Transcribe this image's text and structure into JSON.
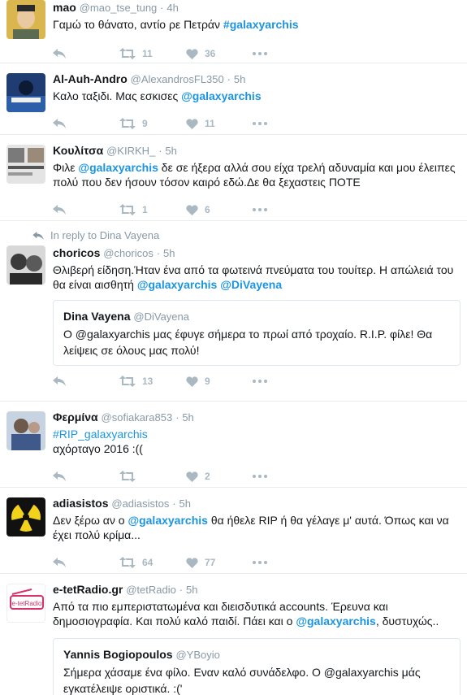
{
  "tweets": [
    {
      "name": "mao",
      "handle": "@mao_tse_tung",
      "sep": "·",
      "time": "4h",
      "text_parts": [
        "Γαμώ το θάνατο, αντίο ρε Πετράν ",
        "#galaxyarchis"
      ],
      "retweets": "11",
      "likes": "36"
    },
    {
      "name": "Al-Auh-Andro",
      "handle": "@AlexandrosFL350",
      "sep": "·",
      "time": "5h",
      "text_parts": [
        "Καλο ταξιδι. Μας εσκισες ",
        "@galaxyarchis"
      ],
      "retweets": "9",
      "likes": "11"
    },
    {
      "name": "Κουλίτσα",
      "handle": "@KIRKH_",
      "sep": "·",
      "time": "5h",
      "text_parts": [
        "Φιλε ",
        "@galaxyarchis",
        " δε σε ήξερα αλλά σου είχα τρελή αδυναμία και μου έλειπες πολύ που δεν ήσουν τόσον καιρό εδώ.Δε θα ξεχαστεις ΠΟΤΕ"
      ],
      "retweets": "1",
      "likes": "6"
    },
    {
      "reply_context": "In reply to Dina Vayena",
      "name": "choricos",
      "handle": "@choricos",
      "sep": "·",
      "time": "5h",
      "text_parts": [
        "Θλιβερή είδηση.Ήταν ένα από τα φωτεινά πνεύματα του τουίτερ. Η απώλειά του θα είναι αισθητή ",
        "@galaxyarchis",
        " ",
        "@DiVayena"
      ],
      "quote": {
        "name": "Dina Vayena",
        "handle": "@DiVayena",
        "text": "Ο @galaxyarchis μας έφυγε σήμερα το πρωί από τροχαίο. R.I.P. φίλε! Θα λείψεις σε όλους μας πολύ!"
      },
      "retweets": "13",
      "likes": "9"
    },
    {
      "name": "Φερμίνα",
      "handle": "@sofiakara853",
      "sep": "·",
      "time": "5h",
      "hashtag": "#RIP_galaxyarchis",
      "text2": "αχόρταγο 2016 :((",
      "retweets": "",
      "likes": "2"
    },
    {
      "name": "adiasistos",
      "handle": "@adiasistos",
      "sep": "·",
      "time": "5h",
      "text_parts": [
        "Δεν ξέρω αν ο ",
        "@galaxyarchis",
        " θα ήθελε RIP ή θα γέλαγε μ' αυτά. Όπως και να έχει πολύ κρίμα..."
      ],
      "retweets": "64",
      "likes": "77"
    },
    {
      "name": "e-tetRadio.gr",
      "handle": "@tetRadio",
      "sep": "·",
      "time": "5h",
      "avatar_text": "e-tetRadio",
      "text_parts": [
        "Από τα πιο εμπεριστατωμένα και διεισδυτικά accounts. Έρευνα και δημοσιογραφία. Και πολύ καλό παιδί. Πάει και ο ",
        "@galaxyarchis",
        ", δυστυχώς.."
      ],
      "quote": {
        "name": "Yannis Bogiopoulos",
        "handle": "@YBoyio",
        "text": "Σήμερα χάσαμε ένα φίλο. Εναν καλό συνάδελφο. Ο @galaxyarchis μάς εγκατέλειψε οριστικά. :('"
      }
    }
  ],
  "colors": {
    "link": "#1b95e0",
    "muted": "#8899a6",
    "action": "#aab8c2",
    "border": "#e6ecf0"
  }
}
